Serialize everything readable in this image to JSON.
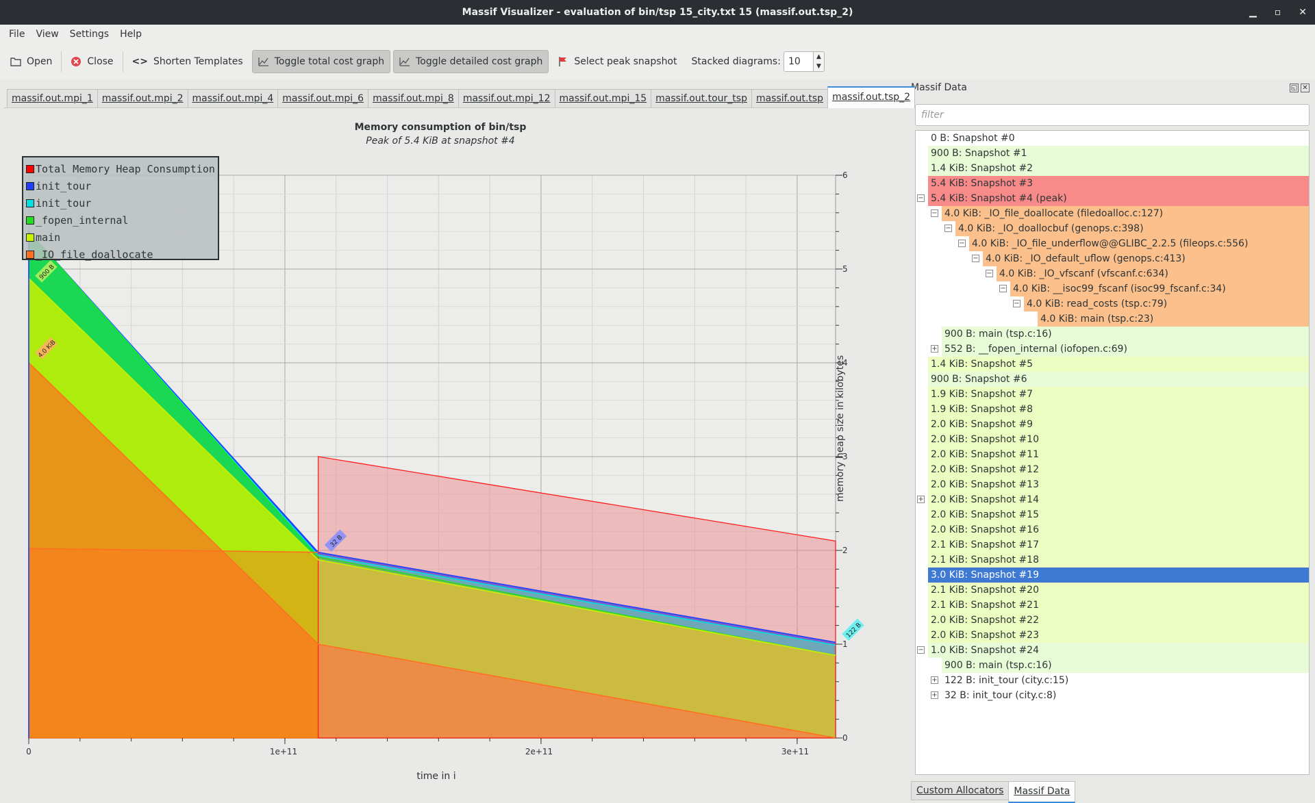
{
  "window": {
    "title": "Massif Visualizer - evaluation of bin/tsp 15_city.txt 15 (massif.out.tsp_2)",
    "minimize": "▁",
    "maximize": "▫",
    "close": "✕"
  },
  "menu": [
    "File",
    "View",
    "Settings",
    "Help"
  ],
  "toolbar": {
    "open": "Open",
    "close": "Close",
    "shorten": "Shorten Templates",
    "toggle_total": "Toggle total cost graph",
    "toggle_detailed": "Toggle detailed cost graph",
    "select_peak": "Select peak snapshot",
    "stacked_label": "Stacked diagrams:",
    "stacked_value": "10"
  },
  "tabs": [
    "massif.out.mpi_1",
    "massif.out.mpi_2",
    "massif.out.mpi_4",
    "massif.out.mpi_6",
    "massif.out.mpi_8",
    "massif.out.mpi_12",
    "massif.out.mpi_15",
    "massif.out.tour_tsp",
    "massif.out.tsp",
    "massif.out.tsp_2"
  ],
  "active_tab": 9,
  "chart": {
    "title": "Memory consumption of bin/tsp",
    "subtitle": "Peak of 5.4 KiB at snapshot #4",
    "xlabel": "time in i",
    "ylabel": "memory heap size in kilobytes",
    "xticks": [
      "0",
      "1e+11",
      "2e+11",
      "3e+11"
    ],
    "yticks": [
      "0",
      "1",
      "2",
      "3",
      "4",
      "5",
      "6"
    ],
    "legend": [
      "Total Memory Heap Consumption",
      "init_tour",
      "init_tour",
      "_fopen_internal",
      "main",
      "_IO_file_doallocate"
    ],
    "annotations": [
      "900 B",
      "4.0 KiB",
      "32 B",
      "122 B"
    ]
  },
  "chart_data": {
    "type": "area",
    "title": "Memory consumption of bin/tsp",
    "subtitle": "Peak of 5.4 KiB at snapshot #4",
    "xlabel": "time in i",
    "ylabel": "memory heap size in kilobytes",
    "xlim": [
      0,
      315000000000.0
    ],
    "ylim": [
      0,
      6
    ],
    "grid": true,
    "legend_position": "top-left",
    "series": [
      {
        "name": "Total Memory Heap Consumption",
        "color": "#ff0000",
        "x": [
          113000000000.0,
          113000000000.0,
          315000000000.0
        ],
        "values": [
          0,
          3.0,
          2.1
        ]
      },
      {
        "name": "init_tour",
        "color": "#2040ff",
        "x": [
          0,
          113000000000.0,
          315000000000.0
        ],
        "values": [
          5.4,
          1.98,
          1.02
        ]
      },
      {
        "name": "init_tour",
        "color": "#00e0e0",
        "x": [
          0,
          113000000000.0,
          315000000000.0
        ],
        "values": [
          5.4,
          1.95,
          0.99
        ]
      },
      {
        "name": "_fopen_internal",
        "color": "#22dd22",
        "x": [
          0,
          113000000000.0,
          315000000000.0
        ],
        "values": [
          5.4,
          1.93,
          0.88
        ]
      },
      {
        "name": "main",
        "color": "#c8f000",
        "x": [
          0,
          113000000000.0,
          315000000000.0
        ],
        "values": [
          4.9,
          1.9,
          0.88
        ]
      },
      {
        "name": "_IO_file_doallocate",
        "color": "#ff7020",
        "x": [
          0,
          113000000000.0,
          315000000000.0
        ],
        "values": [
          4.0,
          1.0,
          0.0
        ]
      },
      {
        "name": "_IO_file_doallocate",
        "color": "#ff7020",
        "x": [
          0,
          113000000000.0
        ],
        "values": [
          2.02,
          1.98
        ]
      }
    ]
  },
  "dock": {
    "title": "Massif Data",
    "filter_placeholder": "filter",
    "tabs": [
      "Custom Allocators",
      "Massif Data"
    ],
    "active_tab": 1,
    "rows": [
      {
        "text": "0 B: Snapshot #0",
        "indent": 0,
        "exp": "",
        "bg": "none"
      },
      {
        "text": "900 B: Snapshot #1",
        "indent": 0,
        "exp": "",
        "bg": "green"
      },
      {
        "text": "1.4 KiB: Snapshot #2",
        "indent": 0,
        "exp": "",
        "bg": "green"
      },
      {
        "text": "5.4 KiB: Snapshot #3",
        "indent": 0,
        "exp": "",
        "bg": "red"
      },
      {
        "text": "5.4 KiB: Snapshot #4 (peak)",
        "indent": 0,
        "exp": "−",
        "bg": "red"
      },
      {
        "text": "4.0 KiB: _IO_file_doallocate (filedoalloc.c:127)",
        "indent": 1,
        "exp": "−",
        "bg": "orange"
      },
      {
        "text": "4.0 KiB: _IO_doallocbuf (genops.c:398)",
        "indent": 2,
        "exp": "−",
        "bg": "orange"
      },
      {
        "text": "4.0 KiB: _IO_file_underflow@@GLIBC_2.2.5 (fileops.c:556)",
        "indent": 3,
        "exp": "−",
        "bg": "orange"
      },
      {
        "text": "4.0 KiB: _IO_default_uflow (genops.c:413)",
        "indent": 4,
        "exp": "−",
        "bg": "orange"
      },
      {
        "text": "4.0 KiB: _IO_vfscanf (vfscanf.c:634)",
        "indent": 5,
        "exp": "−",
        "bg": "orange"
      },
      {
        "text": "4.0 KiB: __isoc99_fscanf (isoc99_fscanf.c:34)",
        "indent": 6,
        "exp": "−",
        "bg": "orange"
      },
      {
        "text": "4.0 KiB: read_costs (tsp.c:79)",
        "indent": 7,
        "exp": "−",
        "bg": "orange"
      },
      {
        "text": "4.0 KiB: main (tsp.c:23)",
        "indent": 8,
        "exp": "",
        "bg": "orange"
      },
      {
        "text": "900 B: main (tsp.c:16)",
        "indent": 1,
        "exp": "",
        "bg": "green"
      },
      {
        "text": "552 B: __fopen_internal (iofopen.c:69)",
        "indent": 1,
        "exp": "+",
        "bg": "green"
      },
      {
        "text": "1.4 KiB: Snapshot #5",
        "indent": 0,
        "exp": "",
        "bg": "yellow"
      },
      {
        "text": "900 B: Snapshot #6",
        "indent": 0,
        "exp": "",
        "bg": "green"
      },
      {
        "text": "1.9 KiB: Snapshot #7",
        "indent": 0,
        "exp": "",
        "bg": "yellow"
      },
      {
        "text": "1.9 KiB: Snapshot #8",
        "indent": 0,
        "exp": "",
        "bg": "yellow"
      },
      {
        "text": "2.0 KiB: Snapshot #9",
        "indent": 0,
        "exp": "",
        "bg": "yellow"
      },
      {
        "text": "2.0 KiB: Snapshot #10",
        "indent": 0,
        "exp": "",
        "bg": "yellow"
      },
      {
        "text": "2.0 KiB: Snapshot #11",
        "indent": 0,
        "exp": "",
        "bg": "yellow"
      },
      {
        "text": "2.0 KiB: Snapshot #12",
        "indent": 0,
        "exp": "",
        "bg": "yellow"
      },
      {
        "text": "2.0 KiB: Snapshot #13",
        "indent": 0,
        "exp": "",
        "bg": "yellow"
      },
      {
        "text": "2.0 KiB: Snapshot #14",
        "indent": 0,
        "exp": "+",
        "bg": "yellow"
      },
      {
        "text": "2.0 KiB: Snapshot #15",
        "indent": 0,
        "exp": "",
        "bg": "yellow"
      },
      {
        "text": "2.0 KiB: Snapshot #16",
        "indent": 0,
        "exp": "",
        "bg": "yellow"
      },
      {
        "text": "2.1 KiB: Snapshot #17",
        "indent": 0,
        "exp": "",
        "bg": "yellow"
      },
      {
        "text": "2.1 KiB: Snapshot #18",
        "indent": 0,
        "exp": "",
        "bg": "yellow"
      },
      {
        "text": "3.0 KiB: Snapshot #19",
        "indent": 0,
        "exp": "",
        "bg": "blue"
      },
      {
        "text": "2.1 KiB: Snapshot #20",
        "indent": 0,
        "exp": "",
        "bg": "yellow"
      },
      {
        "text": "2.1 KiB: Snapshot #21",
        "indent": 0,
        "exp": "",
        "bg": "yellow"
      },
      {
        "text": "2.0 KiB: Snapshot #22",
        "indent": 0,
        "exp": "",
        "bg": "yellow"
      },
      {
        "text": "2.0 KiB: Snapshot #23",
        "indent": 0,
        "exp": "",
        "bg": "yellow"
      },
      {
        "text": "1.0 KiB: Snapshot #24",
        "indent": 0,
        "exp": "−",
        "bg": "green"
      },
      {
        "text": "900 B: main (tsp.c:16)",
        "indent": 1,
        "exp": "",
        "bg": "green"
      },
      {
        "text": "122 B: init_tour (city.c:15)",
        "indent": 1,
        "exp": "+",
        "bg": "none"
      },
      {
        "text": "32 B: init_tour (city.c:8)",
        "indent": 1,
        "exp": "+",
        "bg": "none"
      }
    ]
  }
}
